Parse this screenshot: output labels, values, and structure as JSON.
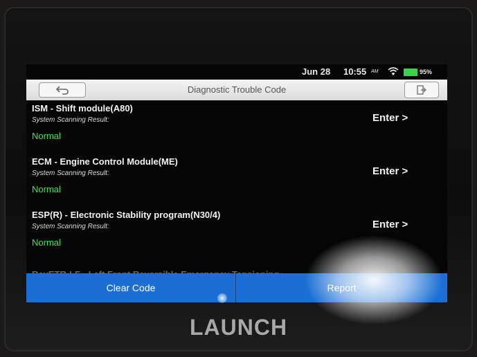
{
  "status_bar": {
    "date": "Jun 28",
    "time": "10:55",
    "ampm": "AM",
    "battery": "95%"
  },
  "title_bar": {
    "title": "Diagnostic Trouble Code"
  },
  "modules": [
    {
      "name": "ISM - Shift module(A80)",
      "scan_label": "System Scanning Result:",
      "status": "Normal",
      "enter_label": "Enter >"
    },
    {
      "name": "ECM - Engine Control Module(ME)",
      "scan_label": "System Scanning Result:",
      "status": "Normal",
      "enter_label": "Enter >"
    },
    {
      "name": "ESP(R) - Electronic Stability program(N30/4)",
      "scan_label": "System Scanning Result:",
      "status": "Normal",
      "enter_label": "Enter >"
    }
  ],
  "partial_item": "RevETR-LF - Left Front Reversible Emergency Tensioning",
  "actions": {
    "clear_code": "Clear Code",
    "report": "Report"
  },
  "brand": "LAUNCH",
  "colors": {
    "accent": "#1b6fd4",
    "status_ok": "#49e05c",
    "title_bg": "#e6e6e6"
  },
  "icons": {
    "back": "back-arrow-icon",
    "exit": "exit-icon",
    "wifi": "wifi-icon",
    "battery": "battery-icon"
  }
}
